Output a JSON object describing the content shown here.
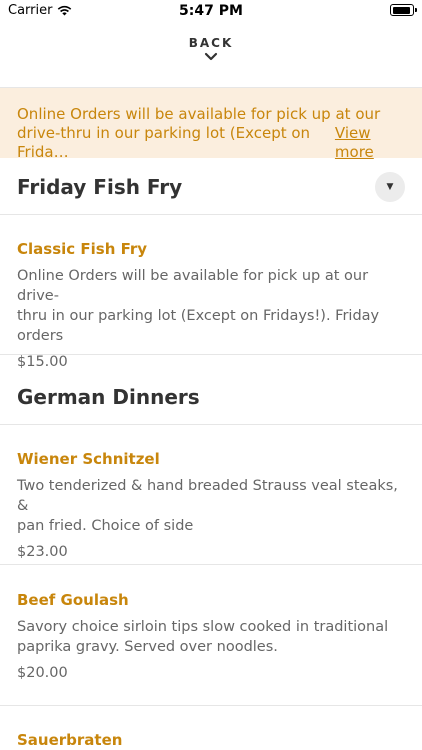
{
  "status_bar": {
    "carrier": "Carrier",
    "time": "5:47 PM"
  },
  "header": {
    "back_label": "BACK"
  },
  "banner": {
    "line1": "Online Orders will be available for pick up at our",
    "line2": "drive-thru in our parking lot (Except on Frida…",
    "view_more": "View more"
  },
  "sections": [
    {
      "title": "Friday Fish Fry",
      "items": [
        {
          "name": "Classic Fish Fry",
          "description_line1": "Online Orders will be available for pick up at our drive-",
          "description_line2": "thru in our parking lot (Except on Fridays!). Friday orders",
          "price": "$15.00"
        }
      ]
    },
    {
      "title": "German Dinners",
      "items": [
        {
          "name": "Wiener Schnitzel",
          "description_line1": "Two tenderized & hand breaded Strauss veal steaks, &",
          "description_line2": "pan fried. Choice of side",
          "price": "$23.00"
        },
        {
          "name": "Beef Goulash",
          "description_line1": "Savory choice sirloin tips slow cooked in traditional",
          "description_line2": "paprika gravy. Served over noodles.",
          "price": "$20.00"
        },
        {
          "name": "Sauerbraten"
        }
      ]
    }
  ],
  "icons": {
    "wifi": "wifi-icon",
    "battery": "battery-icon",
    "back_chevron": "chevron-down-icon",
    "collapse": "caret-down-icon"
  },
  "colors": {
    "accent": "#c8860c",
    "banner_bg": "#fbeede",
    "text": "#333333",
    "muted": "#666666"
  }
}
